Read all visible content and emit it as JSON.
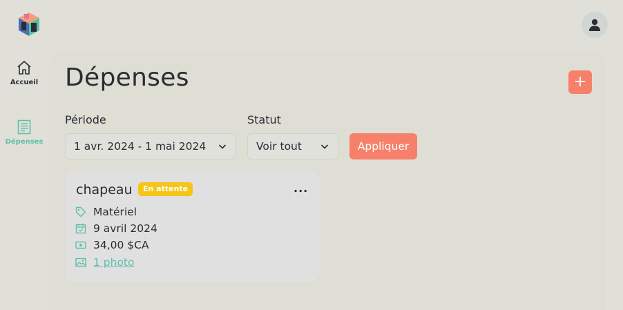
{
  "app": {
    "title": "Dépenses"
  },
  "sidebar": {
    "items": [
      {
        "label": "Accueil",
        "icon": "home-icon"
      },
      {
        "label": "Dépenses",
        "icon": "receipt-icon"
      }
    ]
  },
  "header": {
    "add_label": "+"
  },
  "filters": {
    "period_label": "Période",
    "period_value": "1 avr. 2024 - 1 mai 2024",
    "status_label": "Statut",
    "status_value": "Voir tout",
    "apply_label": "Appliquer"
  },
  "expense": {
    "name": "chapeau",
    "status": "En attente",
    "more": "···",
    "category": "Matériel",
    "date": "9 avril 2024",
    "amount": "34,00 $CA",
    "photos": "1 photo"
  },
  "colors": {
    "accent": "#f6806a",
    "teal": "#5fbfa8",
    "badge": "#f5c518"
  }
}
